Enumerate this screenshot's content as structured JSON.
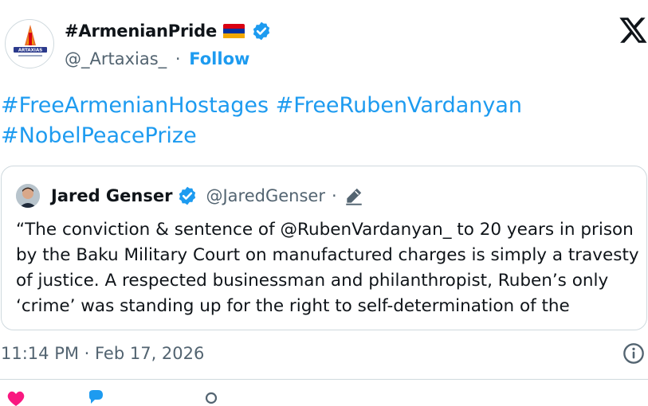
{
  "author": {
    "display_name": "#ArmenianPride",
    "handle": "@_Artaxias_",
    "separator": "·",
    "follow_label": "Follow",
    "avatar_text": "ARTAXIAS"
  },
  "tweet": {
    "text_lines": [
      "#FreeArmenianHostages #FreeRubenVardanyan",
      "#NobelPeacePrize"
    ]
  },
  "quoted": {
    "name": "Jared Genser",
    "handle": "@JaredGenser",
    "separator": "·",
    "body_lines": [
      "“The conviction & sentence of @RubenVardanyan_ to 20 years in prison",
      "by the Baku Military Court on manufactured charges is simply a travesty",
      "of justice. A respected businessman and philanthropist, Ruben’s only",
      "‘crime’ was standing up for the right to self-determination of the"
    ]
  },
  "timestamp": "11:14 PM · Feb 17, 2026",
  "colors": {
    "link": "#1d9bf0",
    "muted": "#536471",
    "verified": "#1d9bf0",
    "like": "#f91880",
    "flag_red": "#d90012",
    "flag_blue": "#0033a0",
    "flag_orange": "#f2a800"
  },
  "icons": [
    "verified-badge-icon",
    "x-logo-icon",
    "edit-pencil-icon",
    "info-icon",
    "heart-icon",
    "reply-icon",
    "copy-link-icon"
  ]
}
